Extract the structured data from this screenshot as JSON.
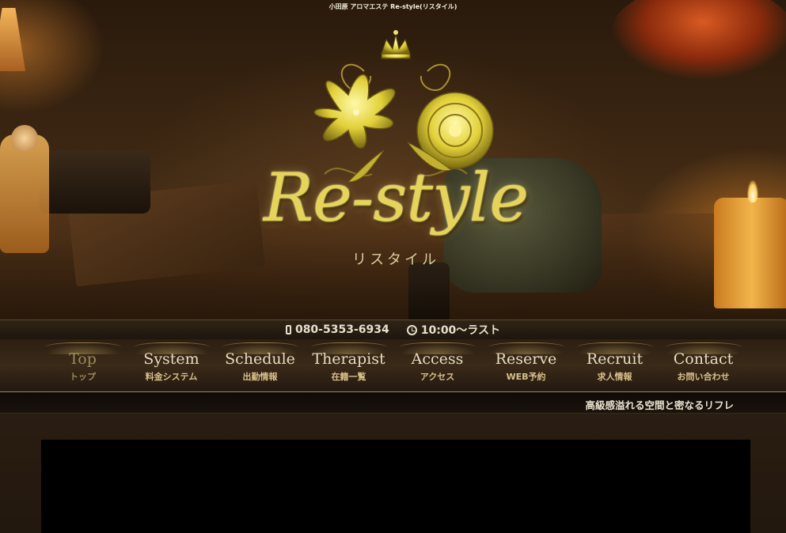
{
  "page": {
    "heading": "小田原 アロマエステ Re-style(リスタイル)"
  },
  "hero": {
    "logo_text": "Re-style",
    "logo_subtext": "リスタイル"
  },
  "info": {
    "phone": "080-5353-6934",
    "hours": "10:00〜ラスト"
  },
  "nav": {
    "items": [
      {
        "en": "Top",
        "ja": "トップ"
      },
      {
        "en": "System",
        "ja": "料金システム"
      },
      {
        "en": "Schedule",
        "ja": "出勤情報"
      },
      {
        "en": "Therapist",
        "ja": "在籍一覧"
      },
      {
        "en": "Access",
        "ja": "アクセス"
      },
      {
        "en": "Reserve",
        "ja": "WEB予約"
      },
      {
        "en": "Recruit",
        "ja": "求人情報"
      },
      {
        "en": "Contact",
        "ja": "お問い合わせ"
      }
    ],
    "active_index": 0
  },
  "tagline": "高級感溢れる空間と密なるリフレ",
  "colors": {
    "gold": "#e6d45a",
    "nav_text": "#e7dcc0",
    "nav_sub": "#d8c08a",
    "background": "#1a1108"
  }
}
